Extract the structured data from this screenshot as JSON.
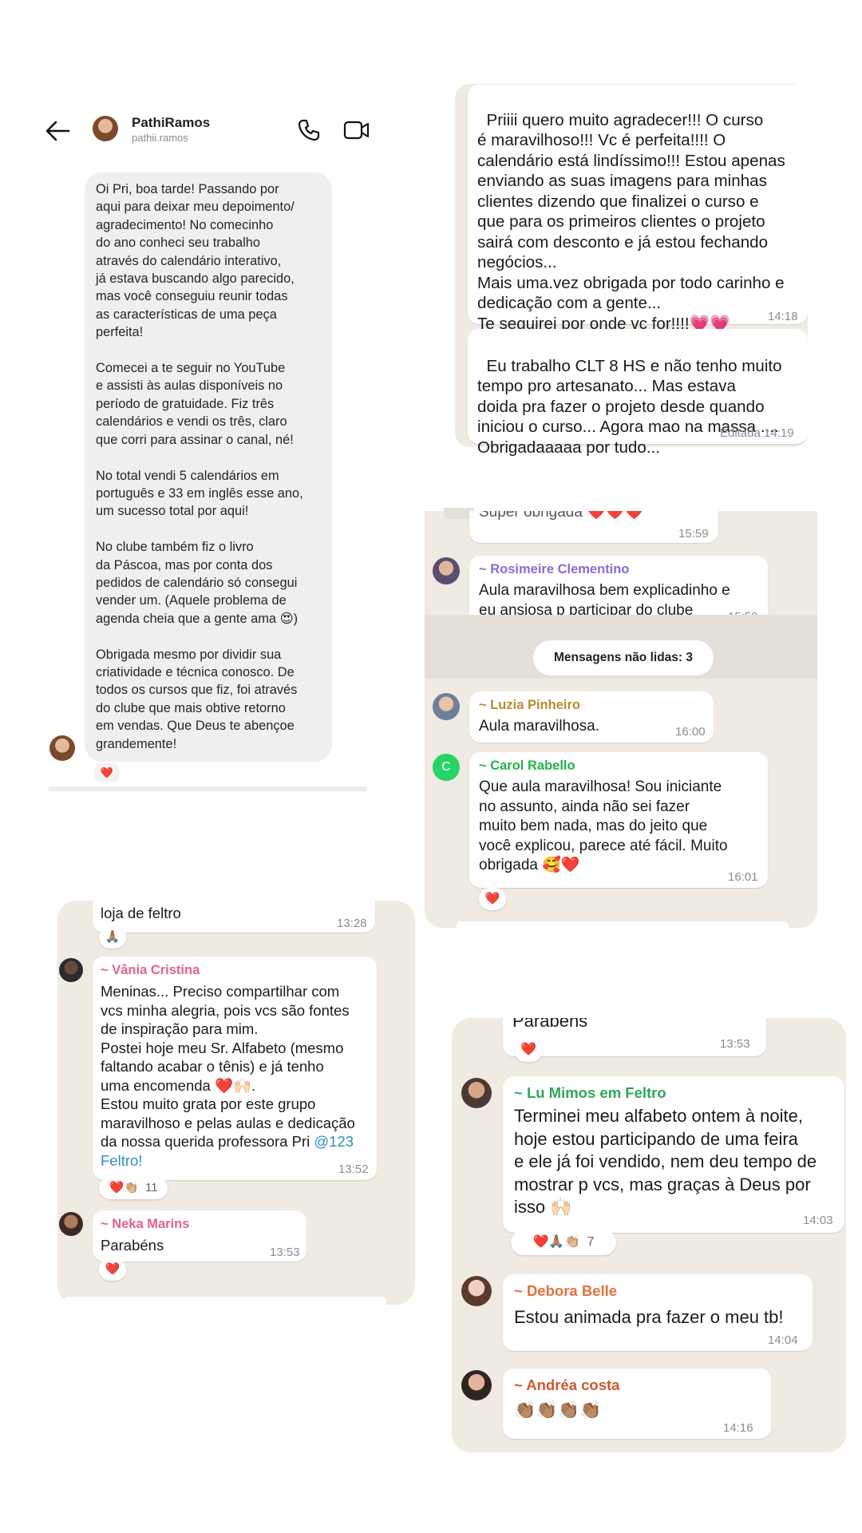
{
  "instagram": {
    "name": "PathiRamos",
    "handle": "pathii.ramos",
    "message": "Oi Pri, boa tarde! Passando por\naqui para deixar meu depoimento/\nagradecimento! No comecinho\ndo ano conheci seu trabalho\natravés do calendário interativo,\njá estava buscando algo parecido,\nmas você conseguiu reunir todas\nas características de uma peça\nperfeita!\n\nComecei a te seguir no YouTube\ne assisti às aulas disponíveis no\nperíodo de gratuidade. Fiz três\ncalendários e vendi os três, claro\nque corri para assinar o canal, né!\n\nNo total vendi 5 calendários em\nportuguês e 33 em inglês esse ano,\num sucesso total por aqui!\n\nNo clube também fiz o livro\nda Páscoa, mas por conta dos\npedidos de calendário só consegui\nvender um. (Aquele problema de\nagenda cheia que a gente ama 😍)\n\nObrigada mesmo por dividir sua\ncriatividade e técnica conosco. De\ntodos os cursos que fiz, foi através\ndo clube que mais obtive retorno\nem vendas. Que Deus te abençoe\ngrandemente!",
    "reaction": "❤️"
  },
  "wa_top": {
    "message1": "Priiii quero muito agradecer!!! O curso\né maravilhoso!!! Vc é perfeita!!!! O\ncalendário está lindíssimo!!! Estou apenas\nenviando as suas imagens para minhas\nclientes dizendo que finalizei o curso e\nque para os primeiros clientes o projeto\nsairá com desconto e já estou fechando\nnegócios...\nMais uma.vez obrigada por todo carinho e\ndedicação com a gente...\nTe seguirei por onde vc for!!!!💗💗",
    "time1": "14:18",
    "message2": "Eu trabalho CLT 8 HS e não tenho muito\ntempo pro artesanato... Mas estava\ndoida pra fazer o projeto desde quando\niniciou o curso... Agora mao na massa ....\nObrigadaaaaa por tudo...",
    "time2": "Editada 14:19"
  },
  "wa_group1": {
    "prev_text": "Super obrigada ❤️❤️❤️",
    "prev_time": "15:59",
    "msg1_sender": "~ Rosimeire Clementino",
    "msg1_text": "Aula maravilhosa bem explicadinho e\neu ansiosa p participar do clube",
    "msg1_time": "15:59",
    "unread": "Mensagens não lidas: 3",
    "msg2_sender": "~ Luzia Pinheiro",
    "msg2_text": "Aula maravilhosa.",
    "msg2_time": "16:00",
    "msg3_avatar_letter": "C",
    "msg3_sender": "~ Carol Rabello",
    "msg3_text": "Que aula maravilhosa! Sou iniciante\nno assunto, ainda não sei fazer\nmuito bem nada, mas do jeito que\nvocê explicou, parece até fácil. Muito\nobrigada 🥰❤️",
    "msg3_time": "16:01",
    "msg3_reaction": "❤️",
    "colors": {
      "rosimeire": "#8a6bd1",
      "luzia": "#b58b2c",
      "carol": "#25b14d"
    }
  },
  "wa_group2": {
    "prev_text": "loja de feltro",
    "prev_time": "13:28",
    "prev_reaction": "🙏🏽",
    "msg1_sender": "~ Vânia Cristina",
    "msg1_text": "Meninas... Preciso compartilhar com\nvcs minha alegria, pois vcs são fontes\nde inspiração para mim.\nPostei hoje meu Sr. Alfabeto (mesmo\nfaltando acabar o tênis) e já tenho\numa encomenda ❤️🙌🏻.\nEstou muito grata por este grupo\nmaravilhoso e pelas aulas e dedicação\nda nossa querida professora Pri ",
    "msg1_mention": "@123\nFeltro!",
    "msg1_time": "13:52",
    "msg1_reactions": "❤️👏🏼",
    "msg1_reaction_count": "11",
    "msg2_sender": "~ Neka Marins",
    "msg2_text": "Parabéns",
    "msg2_time": "13:53",
    "msg2_reaction": "❤️",
    "colors": {
      "sender": "#e0628e",
      "mention": "#2f8fbb"
    }
  },
  "wa_group3": {
    "prev_text": "Parabéns",
    "prev_time": "13:53",
    "prev_reaction": "❤️",
    "msg1_sender": "~ Lu Mimos em Feltro",
    "msg1_text": "Terminei meu alfabeto ontem à noite,\nhoje estou participando de uma feira\ne ele já foi vendido, nem deu tempo de\nmostrar p vcs, mas graças à Deus por\nisso 🙌🏻",
    "msg1_time": "14:03",
    "msg1_reactions": "❤️🙏🏽👏🏼",
    "msg1_reaction_count": "7",
    "msg2_sender": "~ Debora Belle",
    "msg2_text": "Estou animada pra fazer o meu tb!",
    "msg2_time": "14:04",
    "msg3_sender": "~ Andréa costa",
    "msg3_text": "👏🏽👏🏽👏🏽👏🏽",
    "msg3_time": "14:16",
    "colors": {
      "lu": "#2fa65a",
      "debora": "#e0713c",
      "andrea": "#cc5a2e"
    }
  }
}
